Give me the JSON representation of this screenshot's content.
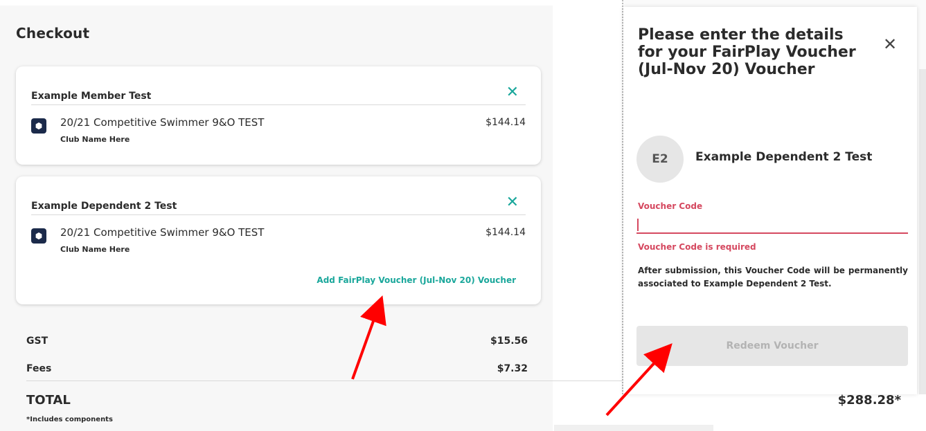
{
  "checkout": {
    "title": "Checkout",
    "cards": [
      {
        "member": "Example Member Test",
        "item_name": "20/21 Competitive Swimmer 9&O TEST",
        "club": "Club Name Here",
        "price": "$144.14"
      },
      {
        "member": "Example Dependent 2 Test",
        "item_name": "20/21 Competitive Swimmer 9&O TEST",
        "club": "Club Name Here",
        "price": "$144.14",
        "add_voucher_link": "Add FairPlay Voucher (Jul-Nov 20) Voucher"
      }
    ],
    "summary": {
      "gst_label": "GST",
      "gst_value": "$15.56",
      "fees_label": "Fees",
      "fees_value": "$7.32",
      "total_label": "TOTAL",
      "total_value": "$288.28*",
      "total_note": "*Includes components"
    }
  },
  "modal": {
    "title": "Please enter the details for your FairPlay Voucher (Jul-Nov 20) Voucher",
    "avatar_initials": "E2",
    "dependent_name": "Example Dependent 2 Test",
    "field_label": "Voucher Code",
    "field_value": "",
    "error_text": "Voucher Code is required",
    "notice": "After submission, this Voucher Code will be permanently associated to Example Dependent 2 Test.",
    "redeem_button": "Redeem Voucher"
  },
  "icons": {
    "remove": "close-icon",
    "item": "package-icon",
    "modal_close": "close-icon",
    "annotation": "red-arrow"
  },
  "colors": {
    "accent": "#1aa79b",
    "error": "#d5485f",
    "arrow": "#ff0000",
    "item_icon_bg": "#1b2a4a"
  }
}
